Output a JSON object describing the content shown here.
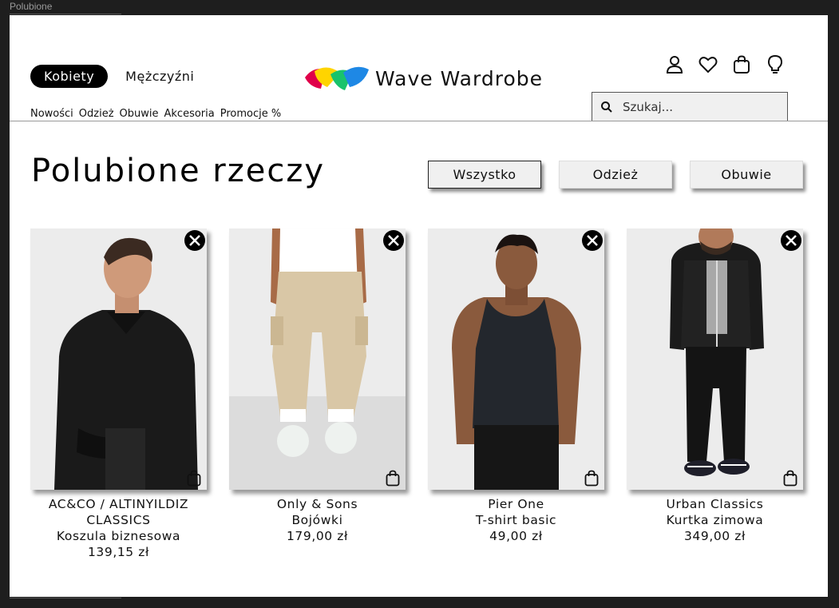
{
  "window": {
    "title": "Polubione"
  },
  "header": {
    "gender_tabs": [
      {
        "label": "Kobiety",
        "active": true
      },
      {
        "label": "Mężczyźni",
        "active": false
      }
    ],
    "brand": "Wave Wardrobe",
    "icons": [
      "user-icon",
      "heart-icon",
      "shopping-bag-icon",
      "lightbulb-icon"
    ],
    "search": {
      "placeholder": "Szukaj...",
      "value": ""
    },
    "categories": [
      "Nowości",
      "Odzież",
      "Obuwie",
      "Akcesoria",
      "Promocje %"
    ]
  },
  "page_title": "Polubione rzeczy",
  "filters": [
    {
      "label": "Wszystko",
      "active": true
    },
    {
      "label": "Odzież",
      "active": false
    },
    {
      "label": "Obuwie",
      "active": false
    }
  ],
  "products": [
    {
      "brand_line1": "AC&CO / ALTINYILDIZ",
      "brand_line2": "CLASSICS",
      "name": "Koszula biznesowa",
      "price": "139,15 zł"
    },
    {
      "brand_line1": "Only & Sons",
      "name": "Bojówki",
      "price": "179,00 zł"
    },
    {
      "brand_line1": "Pier One",
      "name": "T-shirt basic",
      "price": "49,00 zł"
    },
    {
      "brand_line1": "Urban Classics",
      "name": "Kurtka zimowa",
      "price": "349,00 zł"
    }
  ],
  "colors": {
    "logo": [
      "#ffd400",
      "#e0004a",
      "#19c36b",
      "#1e88e5"
    ],
    "pill": "#000000",
    "filter_bg": "#f0f0f0"
  }
}
